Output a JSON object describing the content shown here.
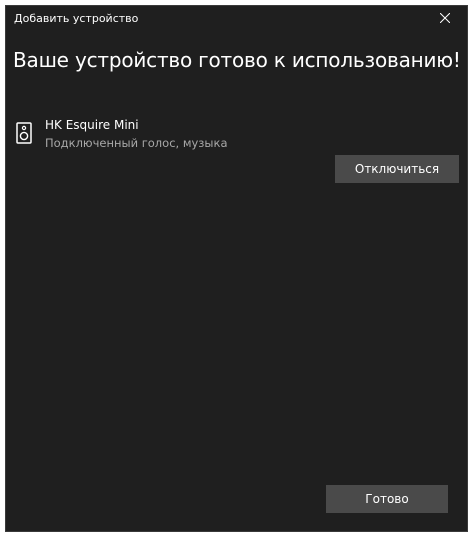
{
  "window": {
    "title": "Добавить устройство"
  },
  "main": {
    "heading": "Ваше устройство готово к использованию!"
  },
  "device": {
    "name": "HK Esquire Mini",
    "status": "Подключенный голос, музыка",
    "icon": "speaker-icon"
  },
  "buttons": {
    "disconnect_label": "Отключиться",
    "done_label": "Готово"
  },
  "colors": {
    "background": "#1f1f1f",
    "button": "#4a4a4a",
    "secondary_text": "#a8a8a8"
  }
}
